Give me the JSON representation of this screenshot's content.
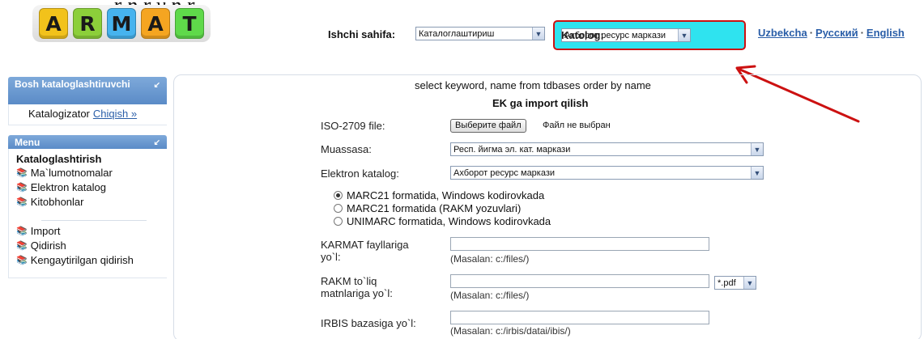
{
  "logo": {
    "letters": [
      "A",
      "R",
      "M",
      "A",
      "T"
    ],
    "colors": [
      "#f2c21b",
      "#8ccf3a",
      "#46b3ee",
      "#f5a521",
      "#5fd94a"
    ]
  },
  "header": {
    "top_text": "r p r y p r",
    "workpage_label": "Ishchi sahifa:",
    "workpage_value": "Каталоглаштириш",
    "katolog_label": "Katolog:",
    "katolog_value": "Ахборот ресурс маркази",
    "languages": [
      "Uzbekcha",
      "Русский",
      "English"
    ],
    "highlight_color": "#2fe3ef",
    "arrow_color": "#cc1111"
  },
  "sidebar": {
    "bosh_header": "Bosh kataloglashtiruvchi",
    "user": "Katalogizator",
    "logout_link": "Chiqish »",
    "menu_header": "Menu",
    "menu_title": "Kataloglashtirish",
    "items_top": [
      "Ma`lumotnomalar",
      "Elektron katalog",
      "Kitobhonlar"
    ],
    "items_bottom": [
      "Import",
      "Qidirish",
      "Kengaytirilgan qidirish"
    ],
    "header_color": "#5a8bc7"
  },
  "main": {
    "query_text": "select keyword, name from tdbases order by name",
    "title": "EK ga import qilish",
    "iso_label": "ISO-2709 file:",
    "file_button": "Выберите файл",
    "file_status": "Файл не выбран",
    "muassasa_label": "Muassasa:",
    "muassasa_value": "Респ. йигма эл. кат. маркази",
    "ek_label": "Elektron katalog:",
    "ek_value": "Ахборот ресурс маркази",
    "format_options": [
      {
        "label": "MARC21 formatida, Windows kodirovkada",
        "checked": true
      },
      {
        "label": "MARC21 formatida (RAKM yozuvlari)",
        "checked": false
      },
      {
        "label": "UNIMARC formatida, Windows kodirovkada",
        "checked": false
      }
    ],
    "karmat_label_1": "KARMAT fayllariga",
    "karmat_label_2": "yo`l:",
    "karmat_hint": "(Masalan: c:/files/)",
    "rakm_label_1": "RAKM to`liq",
    "rakm_label_2": "matnlariga yo`l:",
    "rakm_hint": "(Masalan: c:/files/)",
    "pdf_value": "*.pdf",
    "irbis_label": "IRBIS bazasiga yo`l:",
    "irbis_hint": "(Masalan: c:/irbis/datai/ibis/)"
  }
}
